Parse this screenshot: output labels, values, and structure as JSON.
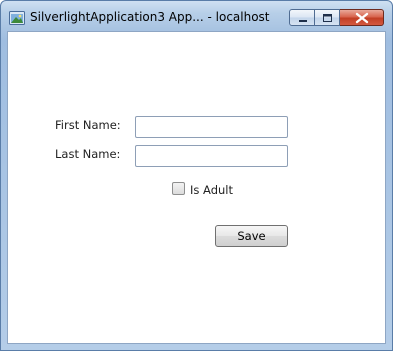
{
  "window": {
    "title": "SilverlightApplication3 App... - localhost",
    "icon": "silverlight-app-icon"
  },
  "controls": {
    "minimize_icon": "minimize-icon",
    "maximize_icon": "maximize-icon",
    "close_icon": "close-icon"
  },
  "form": {
    "first_name_label": "First Name:",
    "first_name_value": "",
    "last_name_label": "Last Name:",
    "last_name_value": "",
    "is_adult_label": "Is Adult",
    "is_adult_checked": false,
    "save_label": "Save"
  },
  "colors": {
    "titlebar": "#a9c4e2",
    "close_button": "#c23f25"
  }
}
